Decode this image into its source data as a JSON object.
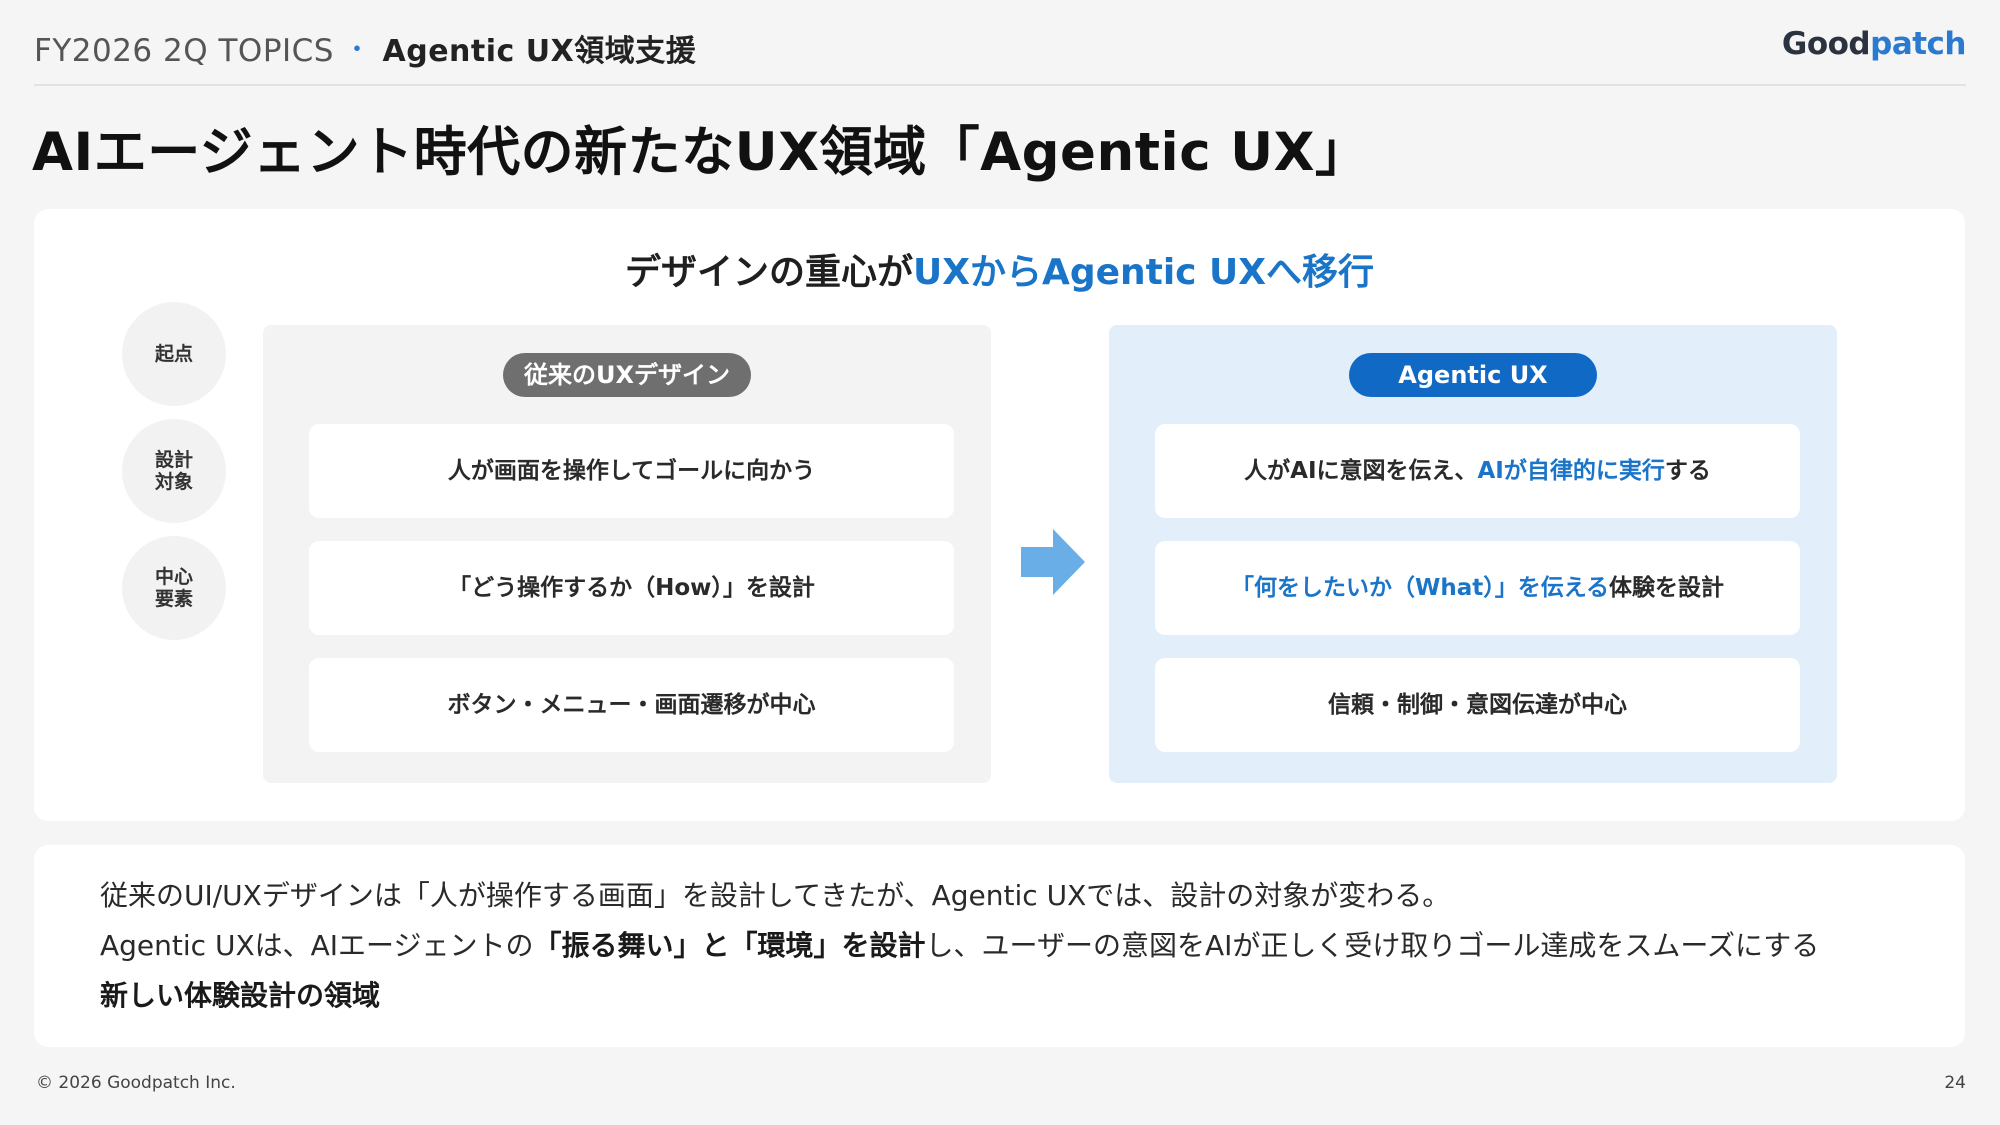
{
  "header": {
    "section": "FY2026 2Q TOPICS",
    "separator": "・",
    "subsection": "Agentic UX領域支援",
    "logo_prefix": "Good",
    "logo_accent": "patch"
  },
  "title": "AIエージェント時代の新たなUX領域「Agentic UX」",
  "diagram": {
    "headline_part1": "デザインの重心が",
    "headline_part2": "UXからAgentic UXへ移行",
    "row_labels": [
      {
        "line1": "起点",
        "line2": ""
      },
      {
        "line1": "設計",
        "line2": "対象"
      },
      {
        "line1": "中心",
        "line2": "要素"
      }
    ],
    "left": {
      "label": "従来のUXデザイン",
      "items": [
        "人が画面を操作してゴールに向かう",
        "「どう操作するか（How）」を設計",
        "ボタン・メニュー・画面遷移が中心"
      ]
    },
    "right": {
      "label": "Agentic UX",
      "item1_a": "人がAIに意図を伝え、",
      "item1_b": "AIが自律的に実行",
      "item1_c": "する",
      "item2_a": "「何をしたいか（What）」を伝える",
      "item2_b": "体験を設計",
      "item3": "信頼・制御・意図伝達が中心"
    },
    "arrow_color": "#6aaee8"
  },
  "note": {
    "line1": "従来のUI/UXデザインは「人が操作する画面」を設計してきたが、Agentic UXでは、設計の対象が変わる。",
    "line2_a": "Agentic UXは、AIエージェントの",
    "line2_b": "「振る舞い」と「環境」を設計",
    "line2_c": "し、ユーザーの意図をAIが正しく受け取りゴール達成をスムーズにする",
    "line3": "新しい体験設計の領域"
  },
  "footer": {
    "copyright": "© 2026 Goodpatch Inc.",
    "page": "24"
  }
}
